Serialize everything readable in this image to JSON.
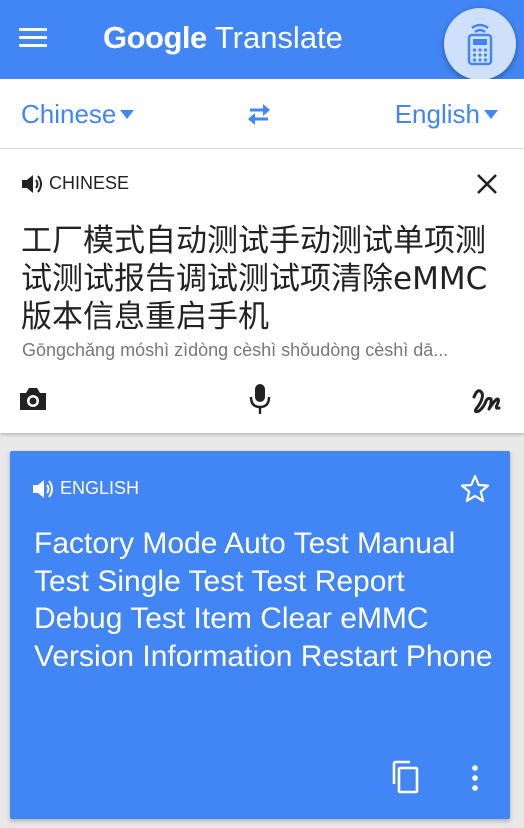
{
  "appbar": {
    "brand": "Google",
    "product": "Translate",
    "color": "#4285f4"
  },
  "languages": {
    "source": "Chinese",
    "target": "English"
  },
  "source_card": {
    "label": "CHINESE",
    "text": "工厂模式自动测试手动测试单项测试测试报告调试测试项清除eMMC版本信息重启手机",
    "transliteration": "Gōngchǎng móshì zìdòng cèshì shǒudòng cèshì dā..."
  },
  "result_card": {
    "label": "ENGLISH",
    "text": "Factory Mode Auto Test Manual Test Single Test Test Report Debug Test Item Clear eMMC Version Information Restart Phone",
    "color": "#4285f4"
  },
  "icons": [
    "menu-icon",
    "remote-icon",
    "swap-icon",
    "speaker-icon",
    "close-icon",
    "camera-icon",
    "microphone-icon",
    "handwriting-icon",
    "star-icon",
    "copy-icon",
    "more-vert-icon"
  ]
}
